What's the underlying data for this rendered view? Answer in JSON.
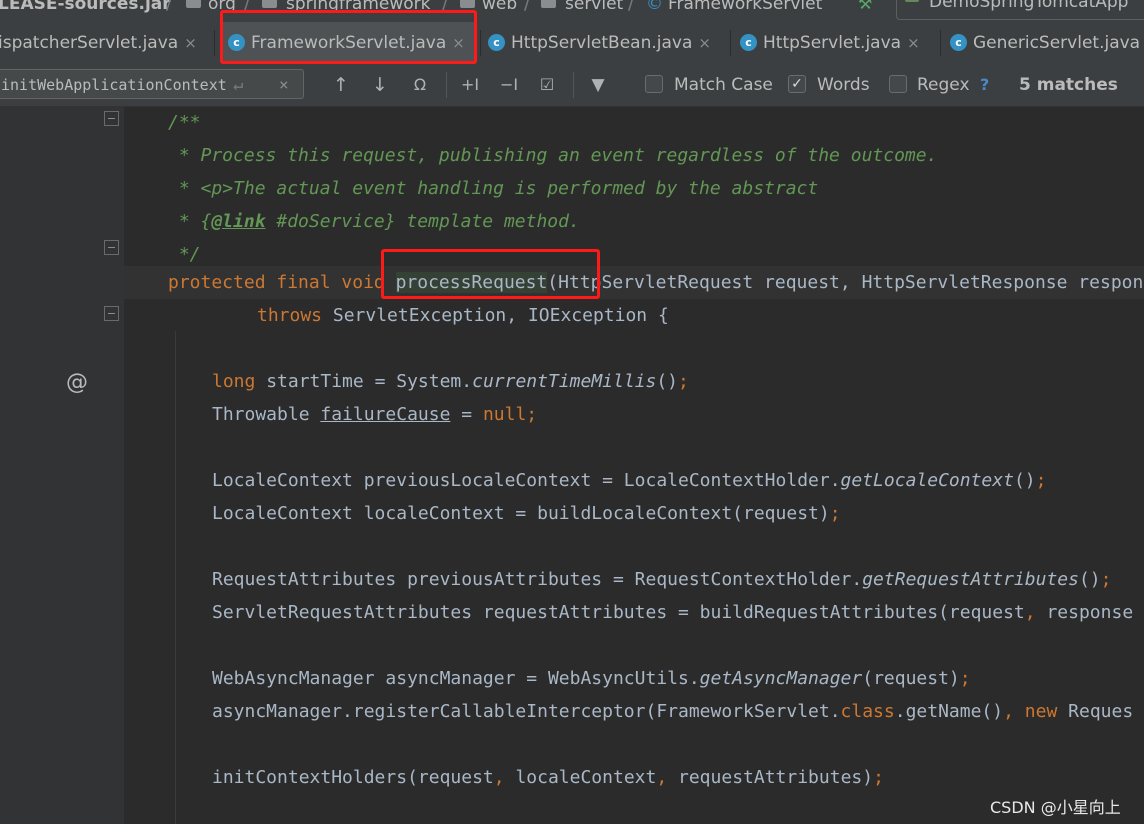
{
  "breadcrumbs": {
    "items": [
      "LEASE-sources.jar",
      "org",
      "springframework",
      "web",
      "servlet",
      "FrameworkServlet"
    ],
    "run_config": "DemoSpringTomcatApp"
  },
  "tabs": [
    {
      "label": "ispatcherServlet.java",
      "active": false
    },
    {
      "label": "FrameworkServlet.java",
      "active": true
    },
    {
      "label": "HttpServletBean.java",
      "active": false
    },
    {
      "label": "HttpServlet.java",
      "active": false
    },
    {
      "label": "GenericServlet.java",
      "active": false
    }
  ],
  "tab_close_glyph": "×",
  "tab_icon_glyph": "c",
  "find": {
    "query": "initWebApplicationContext",
    "match_case_label": "Match Case",
    "match_case": false,
    "words_label": "Words",
    "words": true,
    "regex_label": "Regex",
    "regex": false,
    "help": "?",
    "result": "5 matches"
  },
  "gutter": {
    "annotation_marker": "@"
  },
  "code": {
    "l1": "/**",
    "l2": " * Process this request, publishing an event regardless of the outcome.",
    "l3_a": " * ",
    "l3_tag": "<p>",
    "l3_b": "The actual event handling is performed by the abstract",
    "l4_a": " * {",
    "l4_link": "@link",
    "l4_b": " #doService} template method.",
    "l5": " */",
    "l6_kw": "protected final void ",
    "l6_method": "processRequest",
    "l6_rest": "(HttpServletRequest request, HttpServletResponse response",
    "l7_kw": "throws",
    "l7_rest": " ServletException, IOException {",
    "l8_kw": "long",
    "l8_a": " startTime = System.",
    "l8_static": "currentTimeMillis",
    "l8_b": "()",
    "l8_semi": ";",
    "l9_a": "Throwable ",
    "l9_var": "failureCause",
    "l9_b": " = ",
    "l9_kw": "null",
    "l9_semi": ";",
    "l10_a": "LocaleContext previousLocaleContext = LocaleContextHolder.",
    "l10_static": "getLocaleContext",
    "l10_b": "()",
    "l10_semi": ";",
    "l11_a": "LocaleContext localeContext = buildLocaleContext(request)",
    "l11_semi": ";",
    "l12_a": "RequestAttributes previousAttributes = RequestContextHolder.",
    "l12_static": "getRequestAttributes",
    "l12_b": "()",
    "l12_semi": ";",
    "l13_a": "ServletRequestAttributes requestAttributes = buildRequestAttributes(request",
    "l13_comma": ",",
    "l13_b": " response",
    "l14_a": "WebAsyncManager asyncManager = WebAsyncUtils.",
    "l14_static": "getAsyncManager",
    "l14_b": "(request)",
    "l14_semi": ";",
    "l15_a": "asyncManager.registerCallableInterceptor(FrameworkServlet.",
    "l15_kw": "class",
    "l15_b": ".getName()",
    "l15_comma": ",",
    "l15_kw2": " new",
    "l15_c": " Reques",
    "l16_a": "initContextHolders(request",
    "l16_c1": ",",
    "l16_b": " localeContext",
    "l16_c2": ",",
    "l16_c": " requestAttributes)",
    "l16_semi": ";"
  },
  "watermark": "CSDN @小星向上",
  "colors": {
    "highlight_box": "#ff1a1a",
    "keyword": "#cc7832",
    "doc_comment": "#629755",
    "identifier": "#a9b7c6",
    "editor_bg": "#2b2b2b"
  }
}
